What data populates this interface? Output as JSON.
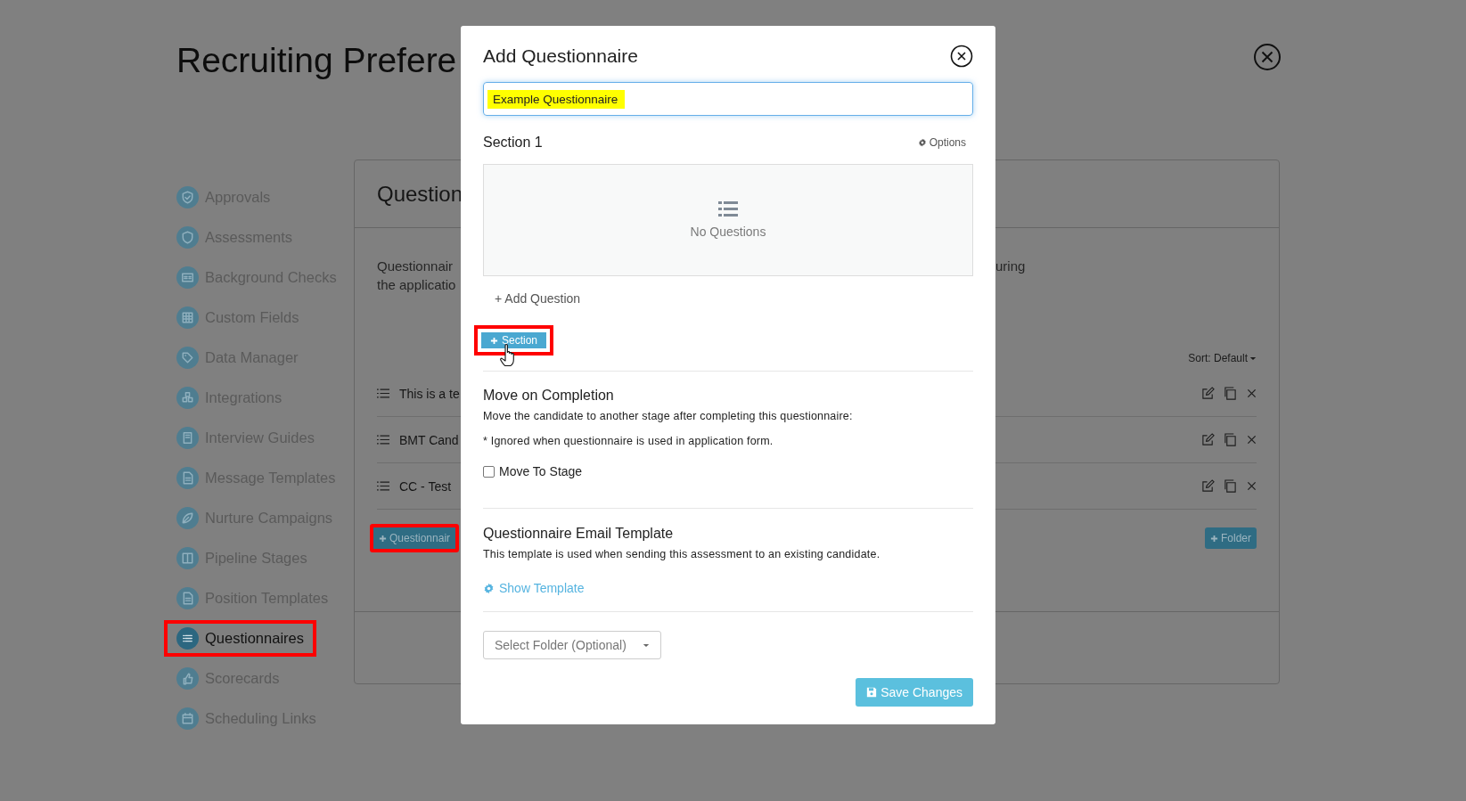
{
  "page": {
    "title": "Recruiting Prefere"
  },
  "sidebar": {
    "items": [
      {
        "label": "Approvals",
        "selected": false,
        "highlighted": false
      },
      {
        "label": "Assessments",
        "selected": false,
        "highlighted": false
      },
      {
        "label": "Background Checks",
        "selected": false,
        "highlighted": false
      },
      {
        "label": "Custom Fields",
        "selected": false,
        "highlighted": false
      },
      {
        "label": "Data Manager",
        "selected": false,
        "highlighted": false
      },
      {
        "label": "Integrations",
        "selected": false,
        "highlighted": false
      },
      {
        "label": "Interview Guides",
        "selected": false,
        "highlighted": false
      },
      {
        "label": "Message Templates",
        "selected": false,
        "highlighted": false
      },
      {
        "label": "Nurture Campaigns",
        "selected": false,
        "highlighted": false
      },
      {
        "label": "Pipeline Stages",
        "selected": false,
        "highlighted": false
      },
      {
        "label": "Position Templates",
        "selected": false,
        "highlighted": false
      },
      {
        "label": "Questionnaires",
        "selected": true,
        "highlighted": true
      },
      {
        "label": "Scorecards",
        "selected": false,
        "highlighted": false
      },
      {
        "label": "Scheduling Links",
        "selected": false,
        "highlighted": false
      }
    ]
  },
  "panel": {
    "title": "Question",
    "description_lines": [
      "Questionnair",
      "the applicatio"
    ],
    "description_right": "uring",
    "sort": "Sort: Default",
    "rows": [
      {
        "label": "This is a te"
      },
      {
        "label": "BMT Cand"
      },
      {
        "label": "CC - Test"
      }
    ],
    "add_button": {
      "label": "Questionnair",
      "highlighted": true
    },
    "folder_button": {
      "label": "Folder"
    }
  },
  "modal": {
    "title": "Add Questionnaire",
    "name_field": {
      "value": "Example Questionnaire",
      "text_highlighted": true
    },
    "sections": [
      {
        "title": "Section 1",
        "options": "Options",
        "empty_text": "No Questions",
        "add_question": "+ Add Question"
      }
    ],
    "add_section_button": {
      "label": "Section",
      "highlighted": true
    },
    "move_on_completion": {
      "title": "Move on Completion",
      "description": "Move the candidate to another stage after completing this questionnaire:",
      "note": "* Ignored when questionnaire is used in application form.",
      "checkbox": {
        "label": "Move To Stage",
        "checked": false
      }
    },
    "email_template": {
      "title": "Questionnaire Email Template",
      "description": "This template is used when sending this assessment to an existing candidate.",
      "link": "Show Template"
    },
    "folder_select": {
      "placeholder": "Select Folder (Optional)"
    },
    "save_button": {
      "label": "Save Changes"
    }
  }
}
